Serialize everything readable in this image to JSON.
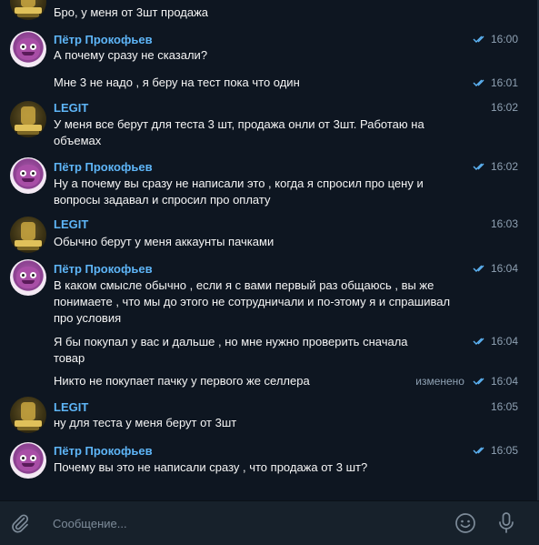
{
  "chat": {
    "top_partial": {
      "text": "Бро, у меня от 3шт продажа"
    },
    "groups": [
      {
        "sender": "Пётр Прокофьев",
        "messages": [
          {
            "text": "А почему сразу не сказали?",
            "time": "16:00",
            "read": true
          },
          {
            "text": "Мне 3 не надо , я беру на тест пока что один",
            "time": "16:01",
            "read": true
          }
        ]
      },
      {
        "sender": "LEGIT",
        "messages": [
          {
            "text": "У меня все берут для теста 3 шт, продажа онли от 3шт. Работаю на объемах",
            "time": "16:02"
          }
        ]
      },
      {
        "sender": "Пётр Прокофьев",
        "messages": [
          {
            "text": "Ну а почему вы сразу не написали это , когда я спросил про цену и вопросы задавал и спросил про оплату",
            "time": "16:02",
            "read": true
          }
        ]
      },
      {
        "sender": "LEGIT",
        "messages": [
          {
            "text": "Обычно берут у меня аккаунты пачками",
            "time": "16:03"
          }
        ]
      },
      {
        "sender": "Пётр Прокофьев",
        "messages": [
          {
            "text": "В каком смысле обычно , если я с вами первый раз общаюсь , вы же понимаете , что мы до этого не сотрудничали и по-этому я и спрашивал про условия",
            "time": "16:04",
            "read": true
          },
          {
            "text": "Я бы покупал у вас и дальше , но мне нужно проверить сначала товар",
            "time": "16:04",
            "read": true
          },
          {
            "text": "Никто не покупает пачку у первого же селлера",
            "time": "16:04",
            "read": true,
            "edited": "изменено"
          }
        ]
      },
      {
        "sender": "LEGIT",
        "messages": [
          {
            "text": "ну для теста у меня берут от 3шт",
            "time": "16:05"
          }
        ]
      },
      {
        "sender": "Пётр Прокофьев",
        "messages": [
          {
            "text": "Почему вы это не написали сразу , что продажа от 3 шт?",
            "time": "16:05",
            "read": true
          }
        ]
      }
    ]
  },
  "composer": {
    "placeholder": "Сообщение...",
    "icons": [
      "paperclip-icon",
      "emoji-icon",
      "microphone-icon"
    ]
  },
  "colors": {
    "background": "#0e1621",
    "composer_bg": "#17212b",
    "sender_name": "#5eb5f7",
    "read_ticks": "#5eb5f7",
    "meta_text": "#8fa1b3"
  }
}
